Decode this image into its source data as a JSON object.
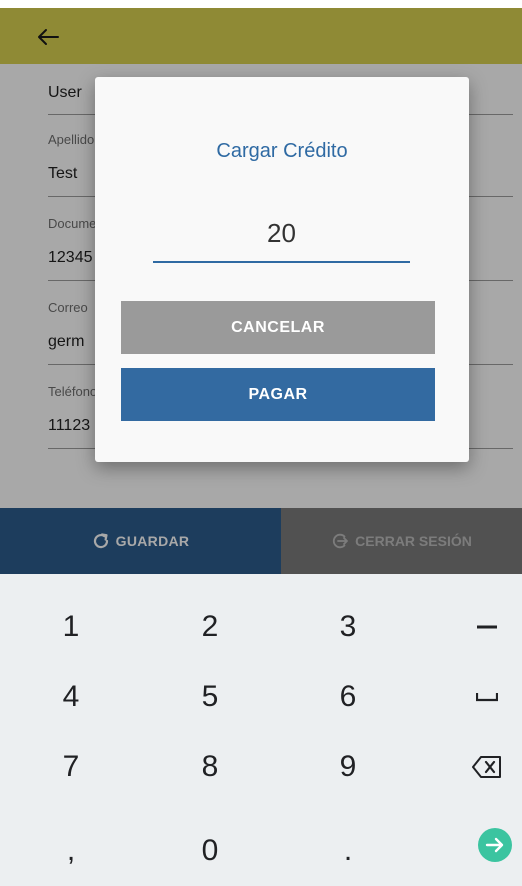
{
  "form": {
    "fields": [
      {
        "label": "",
        "value": "User"
      },
      {
        "label": "Apellido",
        "value": "Test"
      },
      {
        "label": "Documento",
        "value": "12345"
      },
      {
        "label": "Correo",
        "value": "germ"
      },
      {
        "label": "Teléfono",
        "value": "11123"
      }
    ]
  },
  "footer": {
    "save_label": "GUARDAR",
    "logout_label": "CERRAR SESIÓN"
  },
  "dialog": {
    "title": "Cargar Crédito",
    "amount": "20",
    "cancel_label": "CANCELAR",
    "pay_label": "PAGAR"
  },
  "keyboard": {
    "keys": [
      "1",
      "2",
      "3",
      "−",
      "4",
      "5",
      "6",
      "␣",
      "7",
      "8",
      "9",
      "⌫",
      ",",
      "0",
      ".",
      "→"
    ]
  },
  "colors": {
    "header": "#8f8a35",
    "primary": "#336aa1",
    "guardar": "#2c5d8e",
    "cancel": "#9a9a9a",
    "go_key": "#3bc4a0"
  }
}
